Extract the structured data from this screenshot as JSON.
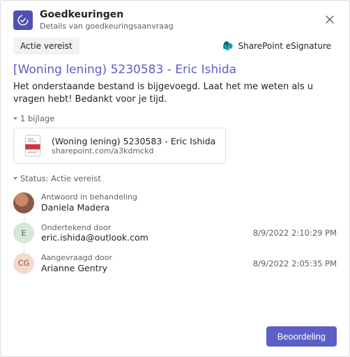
{
  "header": {
    "title": "Goedkeuringen",
    "subtitle": "Details van goedkeuringsaanvraag"
  },
  "action_chip": "Actie vereist",
  "esignature": {
    "label": "SharePoint eSignature"
  },
  "subject": "[Woning lening) 5230583 - Eric Ishida",
  "body": "Het onderstaande bestand is bijgevoegd. Laat het me weten als u vragen hebt! Bedankt voor je tijd.",
  "attachments": {
    "section_label": "1 bijlage",
    "item": {
      "name": "(Woning lening) 5230583 - Eric Ishida",
      "url": "sharepoint.com/a3kdmckd"
    }
  },
  "status": {
    "section_label": "Status: Actie vereist",
    "items": [
      {
        "label": "Antwoord in behandeling",
        "name": "Daniela Madera",
        "avatar_type": "photo",
        "initials": "",
        "time": ""
      },
      {
        "label": "Ondertekend door",
        "name": "eric.ishida@outlook.com",
        "avatar_type": "green",
        "initials": "E",
        "time": "8/9/2022 2:10:29 PM"
      },
      {
        "label": "Aangevraagd door",
        "name": "Arianne Gentry",
        "avatar_type": "orange",
        "initials": "CG",
        "time": "8/9/2022 2:05:35 PM"
      }
    ]
  },
  "footer": {
    "primary": "Beoordeling"
  }
}
